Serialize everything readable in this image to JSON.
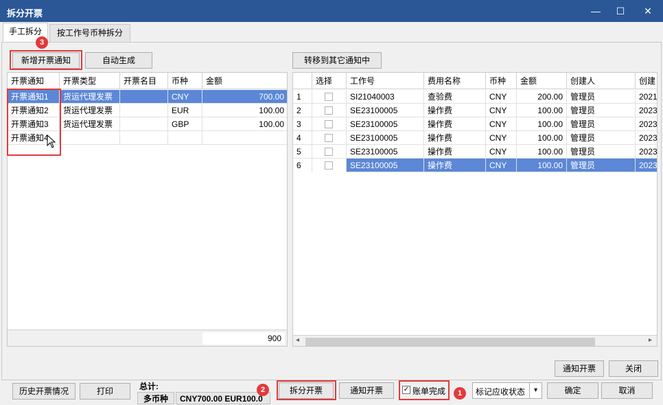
{
  "window": {
    "title": "拆分开票",
    "minimize": "—",
    "maximize": "☐",
    "close": "✕"
  },
  "tabs": [
    {
      "label": "手工拆分"
    },
    {
      "label": "按工作号币种拆分"
    }
  ],
  "left_toolbar": {
    "add_notice": "新增开票通知",
    "auto_generate": "自动生成"
  },
  "right_toolbar": {
    "move_to_other": "转移到其它通知中"
  },
  "badges": {
    "b1": "1",
    "b2": "2",
    "b3": "3"
  },
  "left_grid": {
    "headers": [
      "开票通知",
      "开票类型",
      "开票名目",
      "币种",
      "金额"
    ],
    "rows": [
      [
        "开票通知1",
        "货运代理发票",
        "",
        "CNY",
        "700.00"
      ],
      [
        "开票通知2",
        "货运代理发票",
        "",
        "EUR",
        "100.00"
      ],
      [
        "开票通知3",
        "货运代理发票",
        "",
        "GBP",
        "100.00"
      ],
      [
        "开票通知4",
        "",
        "",
        "",
        ""
      ]
    ],
    "footer_total": "900"
  },
  "right_grid": {
    "headers": [
      "",
      "选择",
      "工作号",
      "费用名称",
      "币种",
      "金额",
      "创建人",
      "创建"
    ],
    "rows": [
      [
        "1",
        "",
        "SI21040003",
        "查验费",
        "CNY",
        "200.00",
        "管理员",
        "2021"
      ],
      [
        "2",
        "",
        "SE23100005",
        "操作费",
        "CNY",
        "100.00",
        "管理员",
        "2023"
      ],
      [
        "3",
        "",
        "SE23100005",
        "操作费",
        "CNY",
        "100.00",
        "管理员",
        "2023"
      ],
      [
        "4",
        "",
        "SE23100005",
        "操作费",
        "CNY",
        "100.00",
        "管理员",
        "2023"
      ],
      [
        "5",
        "",
        "SE23100005",
        "操作费",
        "CNY",
        "100.00",
        "管理员",
        "2023"
      ],
      [
        "6",
        "",
        "SE23100005",
        "操作费",
        "CNY",
        "100.00",
        "管理员",
        "2023"
      ]
    ],
    "scroll_left": "◂",
    "scroll_right": "▸"
  },
  "panel_buttons": {
    "notify_invoice": "通知开票",
    "close": "关闭"
  },
  "bottom": {
    "history": "历史开票情况",
    "print": "打印",
    "total_label": "总计:",
    "multi_currency": "多币种",
    "total_value": "CNY700.00 EUR100.0",
    "split_invoice": "拆分开票",
    "notify_invoice": "通知开票",
    "bill_complete": "账单完成",
    "bill_complete_check": "✓",
    "status_select": "标记应收状态",
    "status_arrow": "▾",
    "confirm": "确定",
    "cancel": "取消"
  }
}
